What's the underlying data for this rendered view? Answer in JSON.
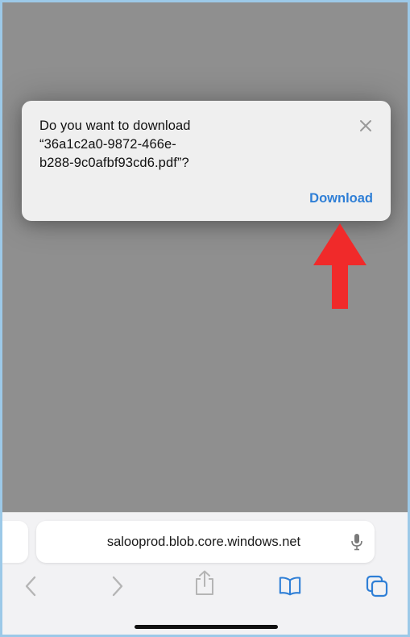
{
  "dialog": {
    "message_line1": "Do you want to download",
    "message_line2": "“36a1c2a0-9872-466e-",
    "message_line3": "b288-9c0afbf93cd6.pdf”?",
    "download_label": "Download"
  },
  "address_bar": {
    "url": "salooprod.blob.core.windows.net"
  },
  "toolbar": {
    "buttons": [
      "back-icon",
      "forward-icon",
      "share-icon",
      "bookmarks-icon",
      "tabs-icon"
    ]
  },
  "colors": {
    "accent": "#2f7fd6",
    "arrow": "#f02a2a",
    "overlay": "#8f8f8f",
    "frame_border": "#9cc9e8"
  }
}
